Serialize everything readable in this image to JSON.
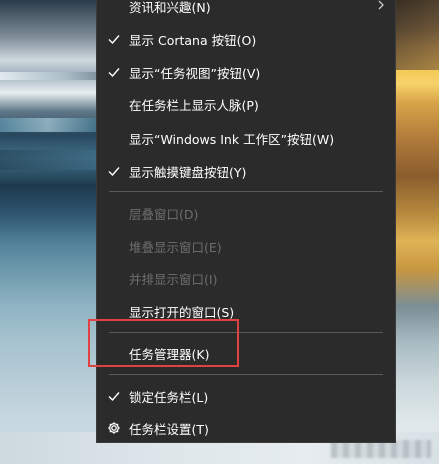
{
  "menu": {
    "items": [
      {
        "label": "资讯和兴趣(N)",
        "checked": false,
        "disabled": false,
        "submenu": true
      },
      {
        "label": "显示 Cortana 按钮(O)",
        "checked": true,
        "disabled": false
      },
      {
        "label": "显示“任务视图”按钮(V)",
        "checked": true,
        "disabled": false
      },
      {
        "label": "在任务栏上显示人脉(P)",
        "checked": false,
        "disabled": false
      },
      {
        "label": "显示“Windows Ink 工作区”按钮(W)",
        "checked": false,
        "disabled": false
      },
      {
        "label": "显示触摸键盘按钮(Y)",
        "checked": true,
        "disabled": false
      },
      {
        "label": "层叠窗口(D)",
        "checked": false,
        "disabled": true
      },
      {
        "label": "堆叠显示窗口(E)",
        "checked": false,
        "disabled": true
      },
      {
        "label": "并排显示窗口(I)",
        "checked": false,
        "disabled": true
      },
      {
        "label": "显示打开的窗口(S)",
        "checked": false,
        "disabled": false
      },
      {
        "label": "任务管理器(K)",
        "checked": false,
        "disabled": false,
        "highlighted": true
      },
      {
        "label": "锁定任务栏(L)",
        "checked": true,
        "disabled": false
      },
      {
        "label": "任务栏设置(T)",
        "checked": false,
        "disabled": false,
        "icon": "gear-icon"
      }
    ]
  },
  "colors": {
    "menu_bg": "#2b2b2b",
    "text": "#ffffff",
    "disabled_text": "#6d6d6d",
    "separator": "#5a5a5a",
    "highlight_border": "#e24141"
  }
}
